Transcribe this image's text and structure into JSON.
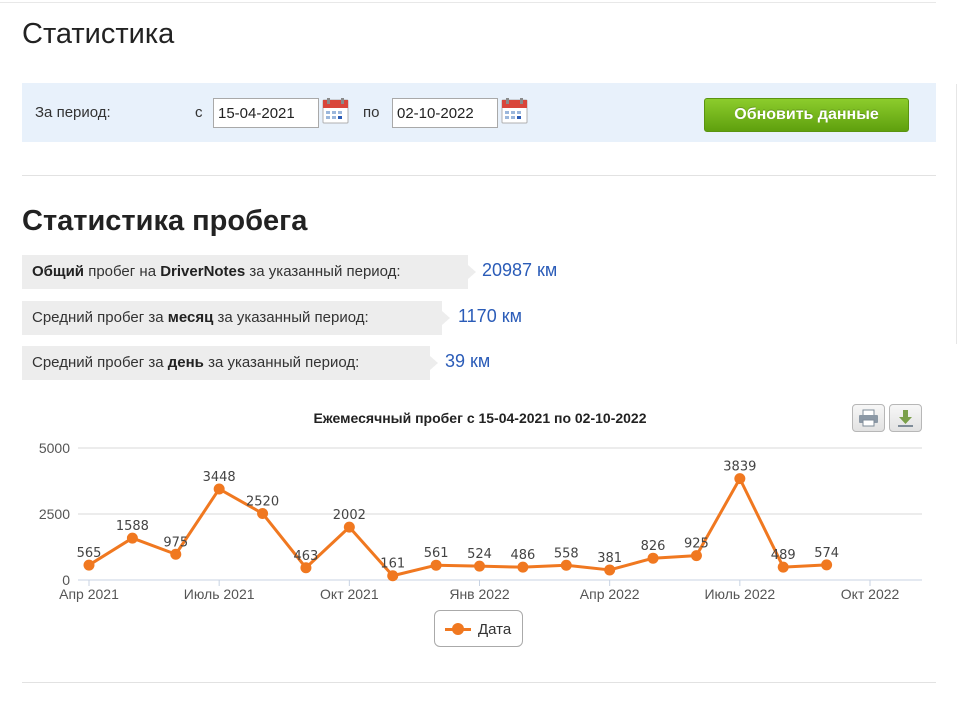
{
  "page": {
    "title": "Статистика"
  },
  "period": {
    "label": "За период:",
    "from_label": "с",
    "from_value": "15-04-2021",
    "to_label": "по",
    "to_value": "02-10-2022",
    "refresh_label": "Обновить данные"
  },
  "mileage": {
    "title": "Статистика пробега",
    "stats": [
      {
        "prefix": "",
        "bold1": "Общий",
        "mid": " пробег на ",
        "bold2": "DriverNotes",
        "suffix": " за указанный период:",
        "value": "20987 км"
      },
      {
        "prefix": "Средний пробег за ",
        "bold1": "месяц",
        "mid": " за указанный период:",
        "bold2": "",
        "suffix": "",
        "value": "1170 км"
      },
      {
        "prefix": "Средний пробег за ",
        "bold1": "день",
        "mid": " за указанный период:",
        "bold2": "",
        "suffix": "",
        "value": "39 км"
      }
    ]
  },
  "colors": {
    "series": "#f07820",
    "value_text": "#2b5cb8",
    "button_green": "#6fb31a",
    "period_bg": "#e8f1fb"
  },
  "icons": {
    "calendar": "calendar-icon",
    "print": "print-icon",
    "download": "download-icon"
  },
  "chart_data": {
    "type": "line",
    "title": "Ежемесячный пробег с 15-04-2021 по 02-10-2022",
    "xlabel": "",
    "ylabel": "",
    "ylim": [
      0,
      5000
    ],
    "yticks": [
      "0",
      "2500",
      "5000"
    ],
    "x_ticks": [
      "Апр 2021",
      "Июль 2021",
      "Окт 2021",
      "Янв 2022",
      "Апр 2022",
      "Июль 2022",
      "Окт 2022"
    ],
    "x_range": [
      "2021-04",
      "2022-10"
    ],
    "x": [
      "2021-04",
      "2021-05",
      "2021-06",
      "2021-07",
      "2021-08",
      "2021-09",
      "2021-10",
      "2021-11",
      "2021-12",
      "2022-01",
      "2022-02",
      "2022-03",
      "2022-04",
      "2022-05",
      "2022-06",
      "2022-07",
      "2022-08",
      "2022-09"
    ],
    "series": [
      {
        "name": "Дата",
        "values": [
          565,
          1588,
          975,
          3448,
          2520,
          463,
          2002,
          161,
          561,
          524,
          486,
          558,
          381,
          826,
          925,
          3839,
          489,
          574
        ]
      }
    ],
    "grid": true,
    "legend": "bottom-center"
  }
}
